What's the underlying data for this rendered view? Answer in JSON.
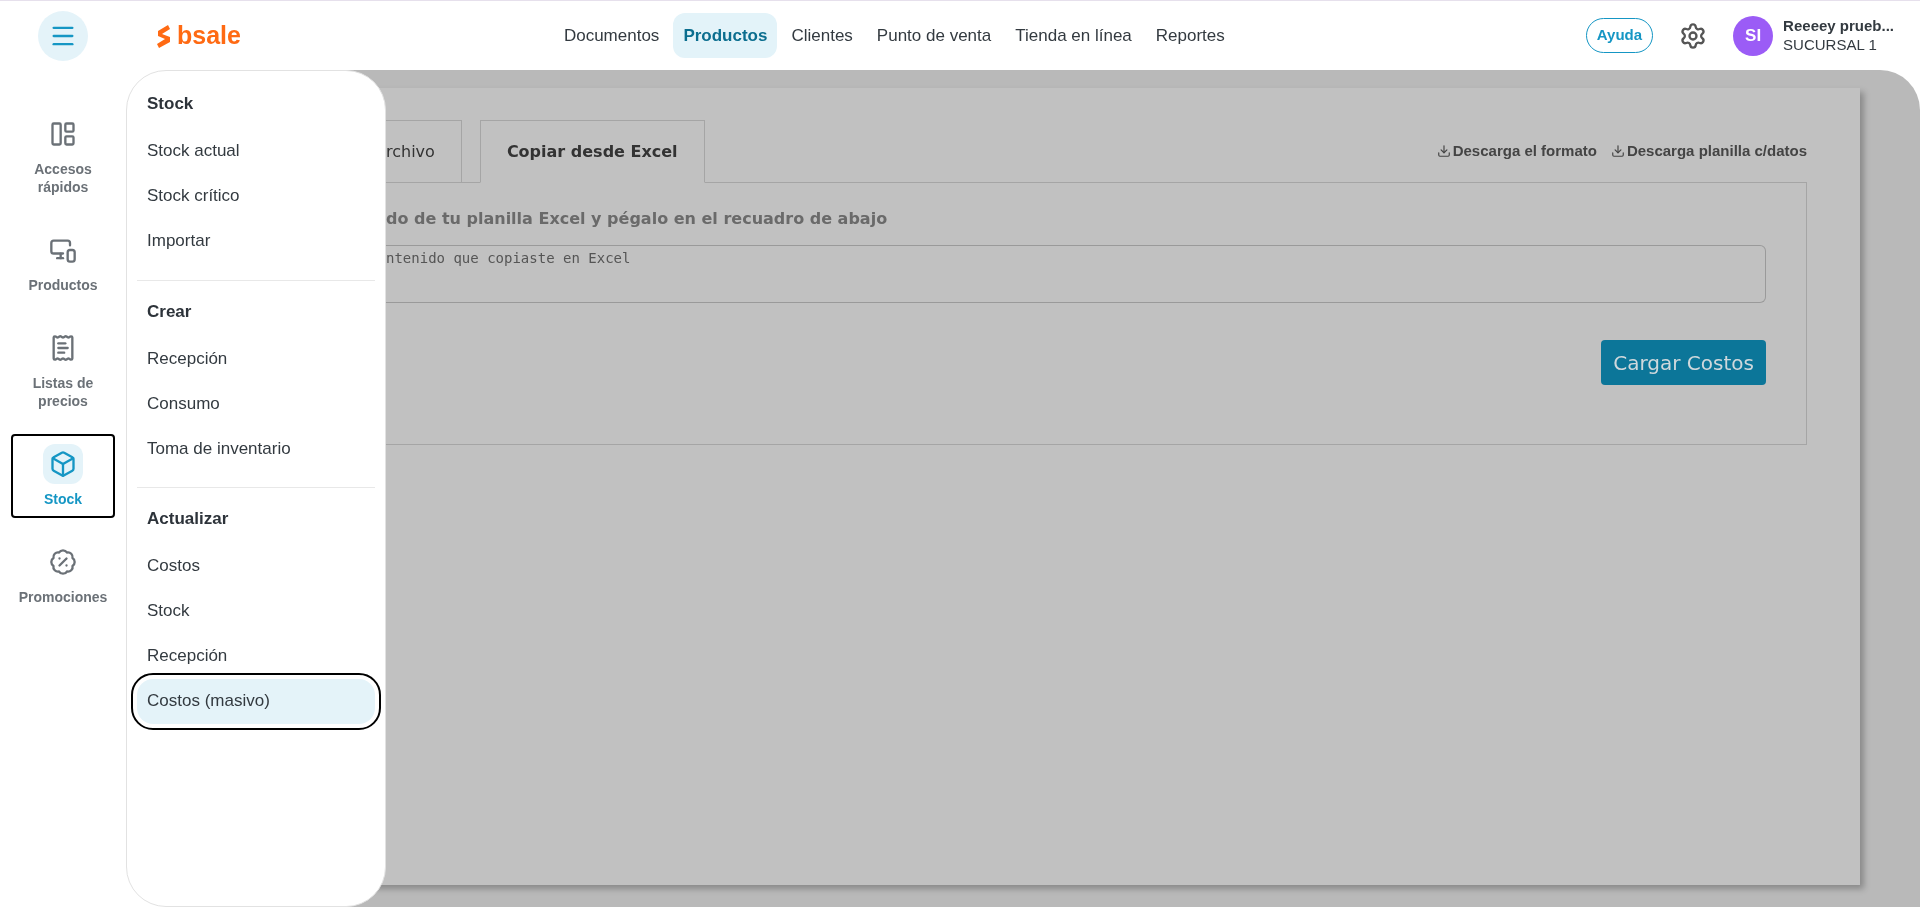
{
  "header": {
    "logo": "bsale",
    "nav": [
      {
        "label": "Documentos",
        "selected": false
      },
      {
        "label": "Productos",
        "selected": true
      },
      {
        "label": "Clientes",
        "selected": false
      },
      {
        "label": "Punto de venta",
        "selected": false
      },
      {
        "label": "Tienda en línea",
        "selected": false
      },
      {
        "label": "Reportes",
        "selected": false
      }
    ],
    "help": "Ayuda",
    "user": {
      "initials": "SI",
      "name": "Reeeey prueb...",
      "branch": "SUCURSAL 1"
    }
  },
  "rail": [
    {
      "kind": "panels",
      "label": "Accesos rápidos",
      "selected": false
    },
    {
      "kind": "devices",
      "label": "Productos",
      "selected": false
    },
    {
      "kind": "pricelist",
      "label": "Listas de precios",
      "selected": false
    },
    {
      "kind": "box",
      "label": "Stock",
      "selected": true
    },
    {
      "kind": "percent",
      "label": "Promociones",
      "selected": false
    }
  ],
  "menu": [
    {
      "title": "Stock",
      "items": [
        {
          "label": "Stock actual",
          "selected": false
        },
        {
          "label": "Stock crítico",
          "selected": false
        },
        {
          "label": "Importar",
          "selected": false
        }
      ]
    },
    {
      "title": "Crear",
      "items": [
        {
          "label": "Recepción",
          "selected": false
        },
        {
          "label": "Consumo",
          "selected": false
        },
        {
          "label": "Toma de inventario",
          "selected": false
        }
      ]
    },
    {
      "title": "Actualizar",
      "items": [
        {
          "label": "Costos",
          "selected": false
        },
        {
          "label": "Stock",
          "selected": false
        },
        {
          "label": "Recepción",
          "selected": false
        },
        {
          "label": "Costos (masivo)",
          "selected": true
        }
      ]
    }
  ],
  "content": {
    "tabs": [
      {
        "label": "rchivo",
        "selected": false
      },
      {
        "label": "Copiar desde Excel",
        "selected": true
      }
    ],
    "links": [
      "Descarga el formato",
      "Descarga planilla c/datos"
    ],
    "instruction": "do de tu planilla Excel y pégalo en el recuadro de abajo",
    "paste_field": {
      "placeholder": "ntenido que copiaste en Excel"
    },
    "button": "Cargar Costos"
  }
}
